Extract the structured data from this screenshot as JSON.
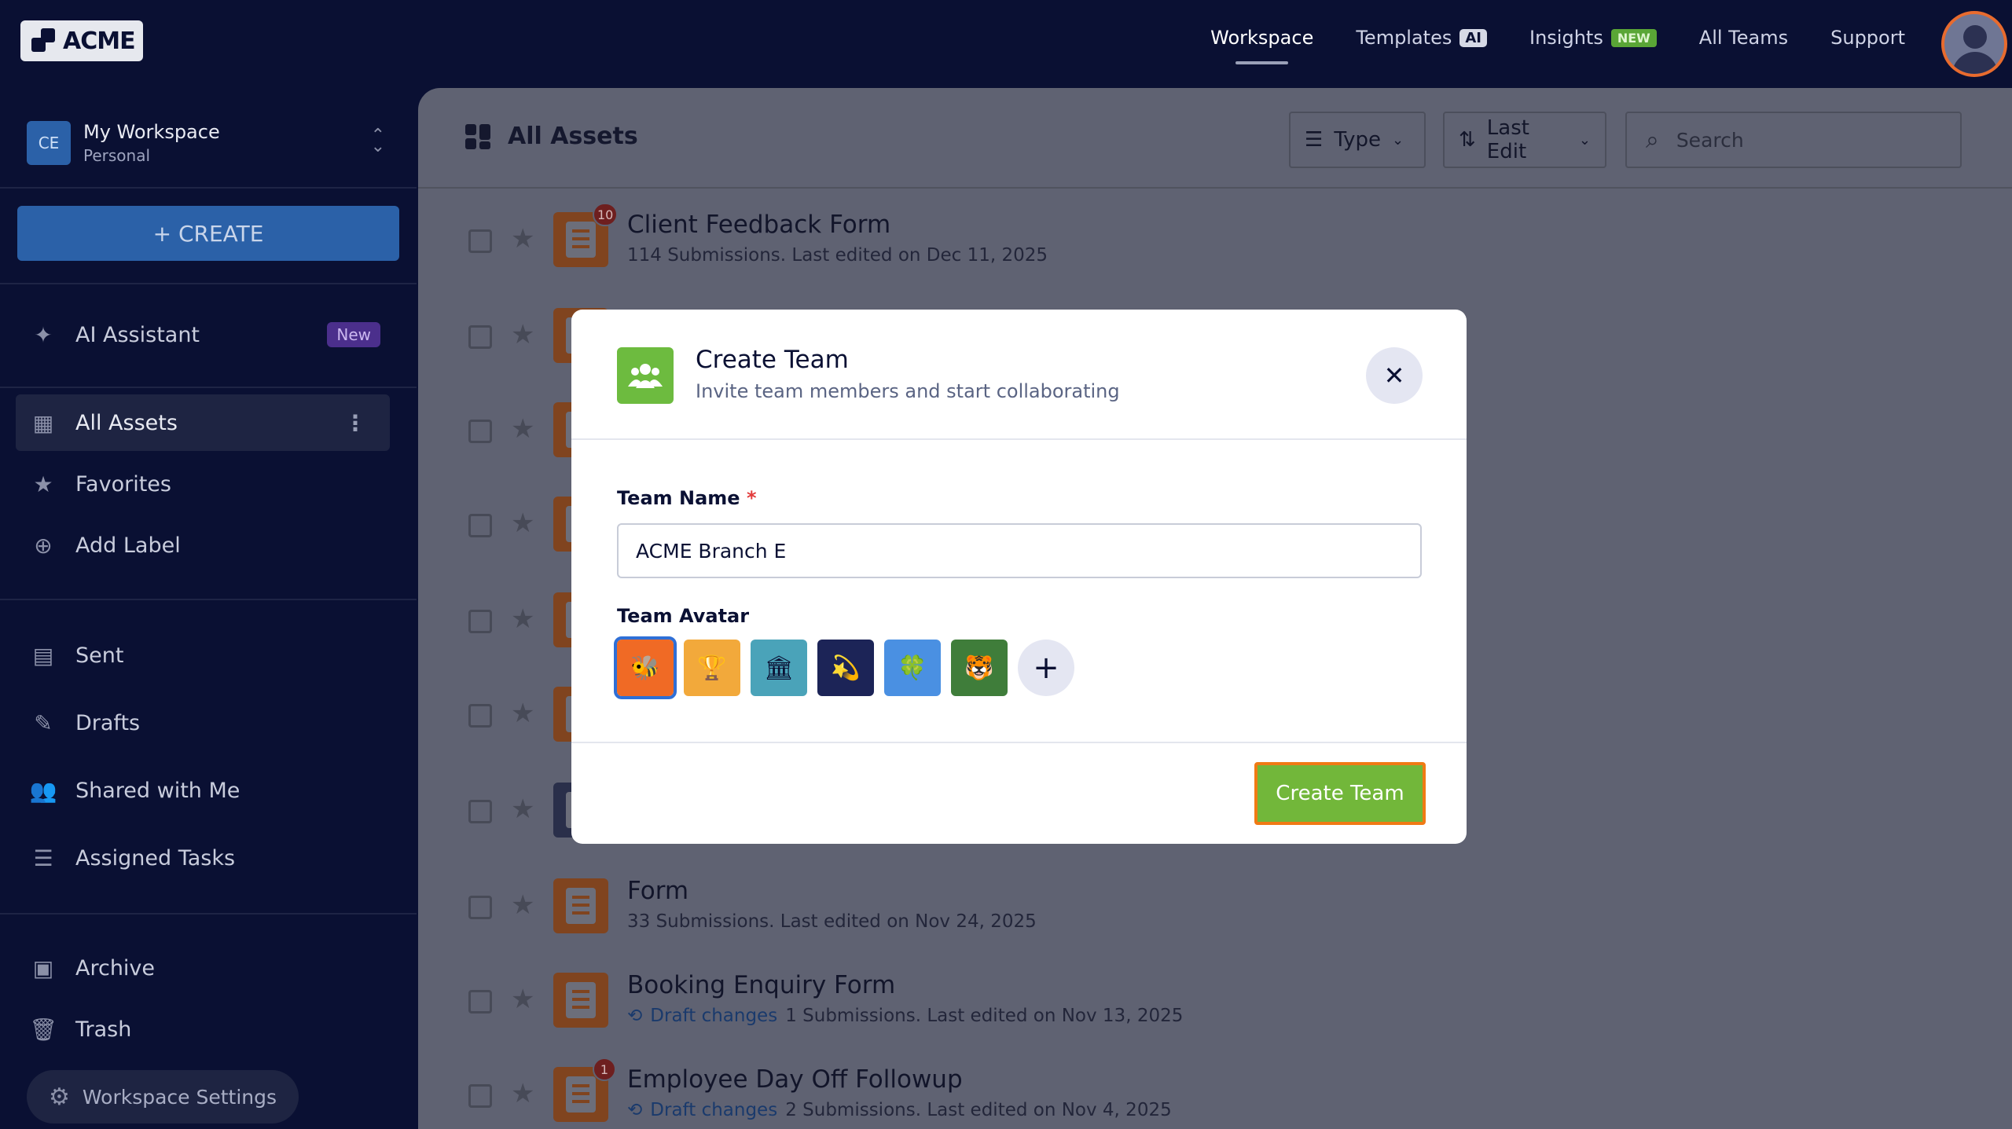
{
  "logo": {
    "text": "ACME"
  },
  "nav": {
    "items": [
      {
        "label": "Workspace",
        "active": true
      },
      {
        "label": "Templates",
        "badge": "AI"
      },
      {
        "label": "Insights",
        "badge": "NEW"
      },
      {
        "label": "All Teams"
      },
      {
        "label": "Support"
      }
    ]
  },
  "sidebar": {
    "workspace": {
      "initials": "CE",
      "name": "My Workspace",
      "type": "Personal"
    },
    "create_label": "+ CREATE",
    "ai_assistant": {
      "label": "AI Assistant",
      "badge": "New"
    },
    "items": [
      {
        "label": "All Assets",
        "active": true
      },
      {
        "label": "Favorites"
      },
      {
        "label": "Add Label"
      },
      {
        "label": "Sent"
      },
      {
        "label": "Drafts"
      },
      {
        "label": "Shared with Me"
      },
      {
        "label": "Assigned Tasks"
      },
      {
        "label": "Archive"
      },
      {
        "label": "Trash"
      }
    ],
    "settings_label": "Workspace Settings"
  },
  "main": {
    "title": "All Assets",
    "filters": {
      "type_label": "Type",
      "sort_label": "Last Edit"
    },
    "search": {
      "placeholder": "Search"
    },
    "rows": [
      {
        "title": "Client Feedback Form",
        "sub": "114 Submissions. Last edited on Dec 11, 2025",
        "badge": "10",
        "draft": ""
      },
      {
        "title": "Form",
        "sub": "33 Submissions. Last edited on Nov 24, 2025",
        "badge": "",
        "draft": ""
      },
      {
        "title": "Booking Enquiry Form",
        "sub": "1 Submissions. Last edited on Nov 13, 2025",
        "badge": "",
        "draft": "Draft changes"
      },
      {
        "title": "Employee Day Off Followup",
        "sub": "2 Submissions. Last edited on Nov 4, 2025",
        "badge": "1",
        "draft": "Draft changes"
      }
    ]
  },
  "modal": {
    "title": "Create Team",
    "subtitle": "Invite team members and start collaborating",
    "team_name_label": "Team Name",
    "required_mark": "*",
    "team_name_value": "ACME Branch E",
    "team_avatar_label": "Team Avatar",
    "avatars": [
      {
        "glyph": "🐝",
        "bg": "#f06a25",
        "selected": true
      },
      {
        "glyph": "🏆",
        "bg": "#f2a93b",
        "selected": false
      },
      {
        "glyph": "🏛",
        "bg": "#4aa3b9",
        "selected": false
      },
      {
        "glyph": "💫",
        "bg": "#1c2457",
        "selected": false
      },
      {
        "glyph": "🍀",
        "bg": "#4a90e2",
        "selected": false
      },
      {
        "glyph": "🐯",
        "bg": "#3f7d3a",
        "selected": false
      }
    ],
    "add_avatar": "+",
    "close": "✕",
    "submit_label": "Create Team"
  }
}
